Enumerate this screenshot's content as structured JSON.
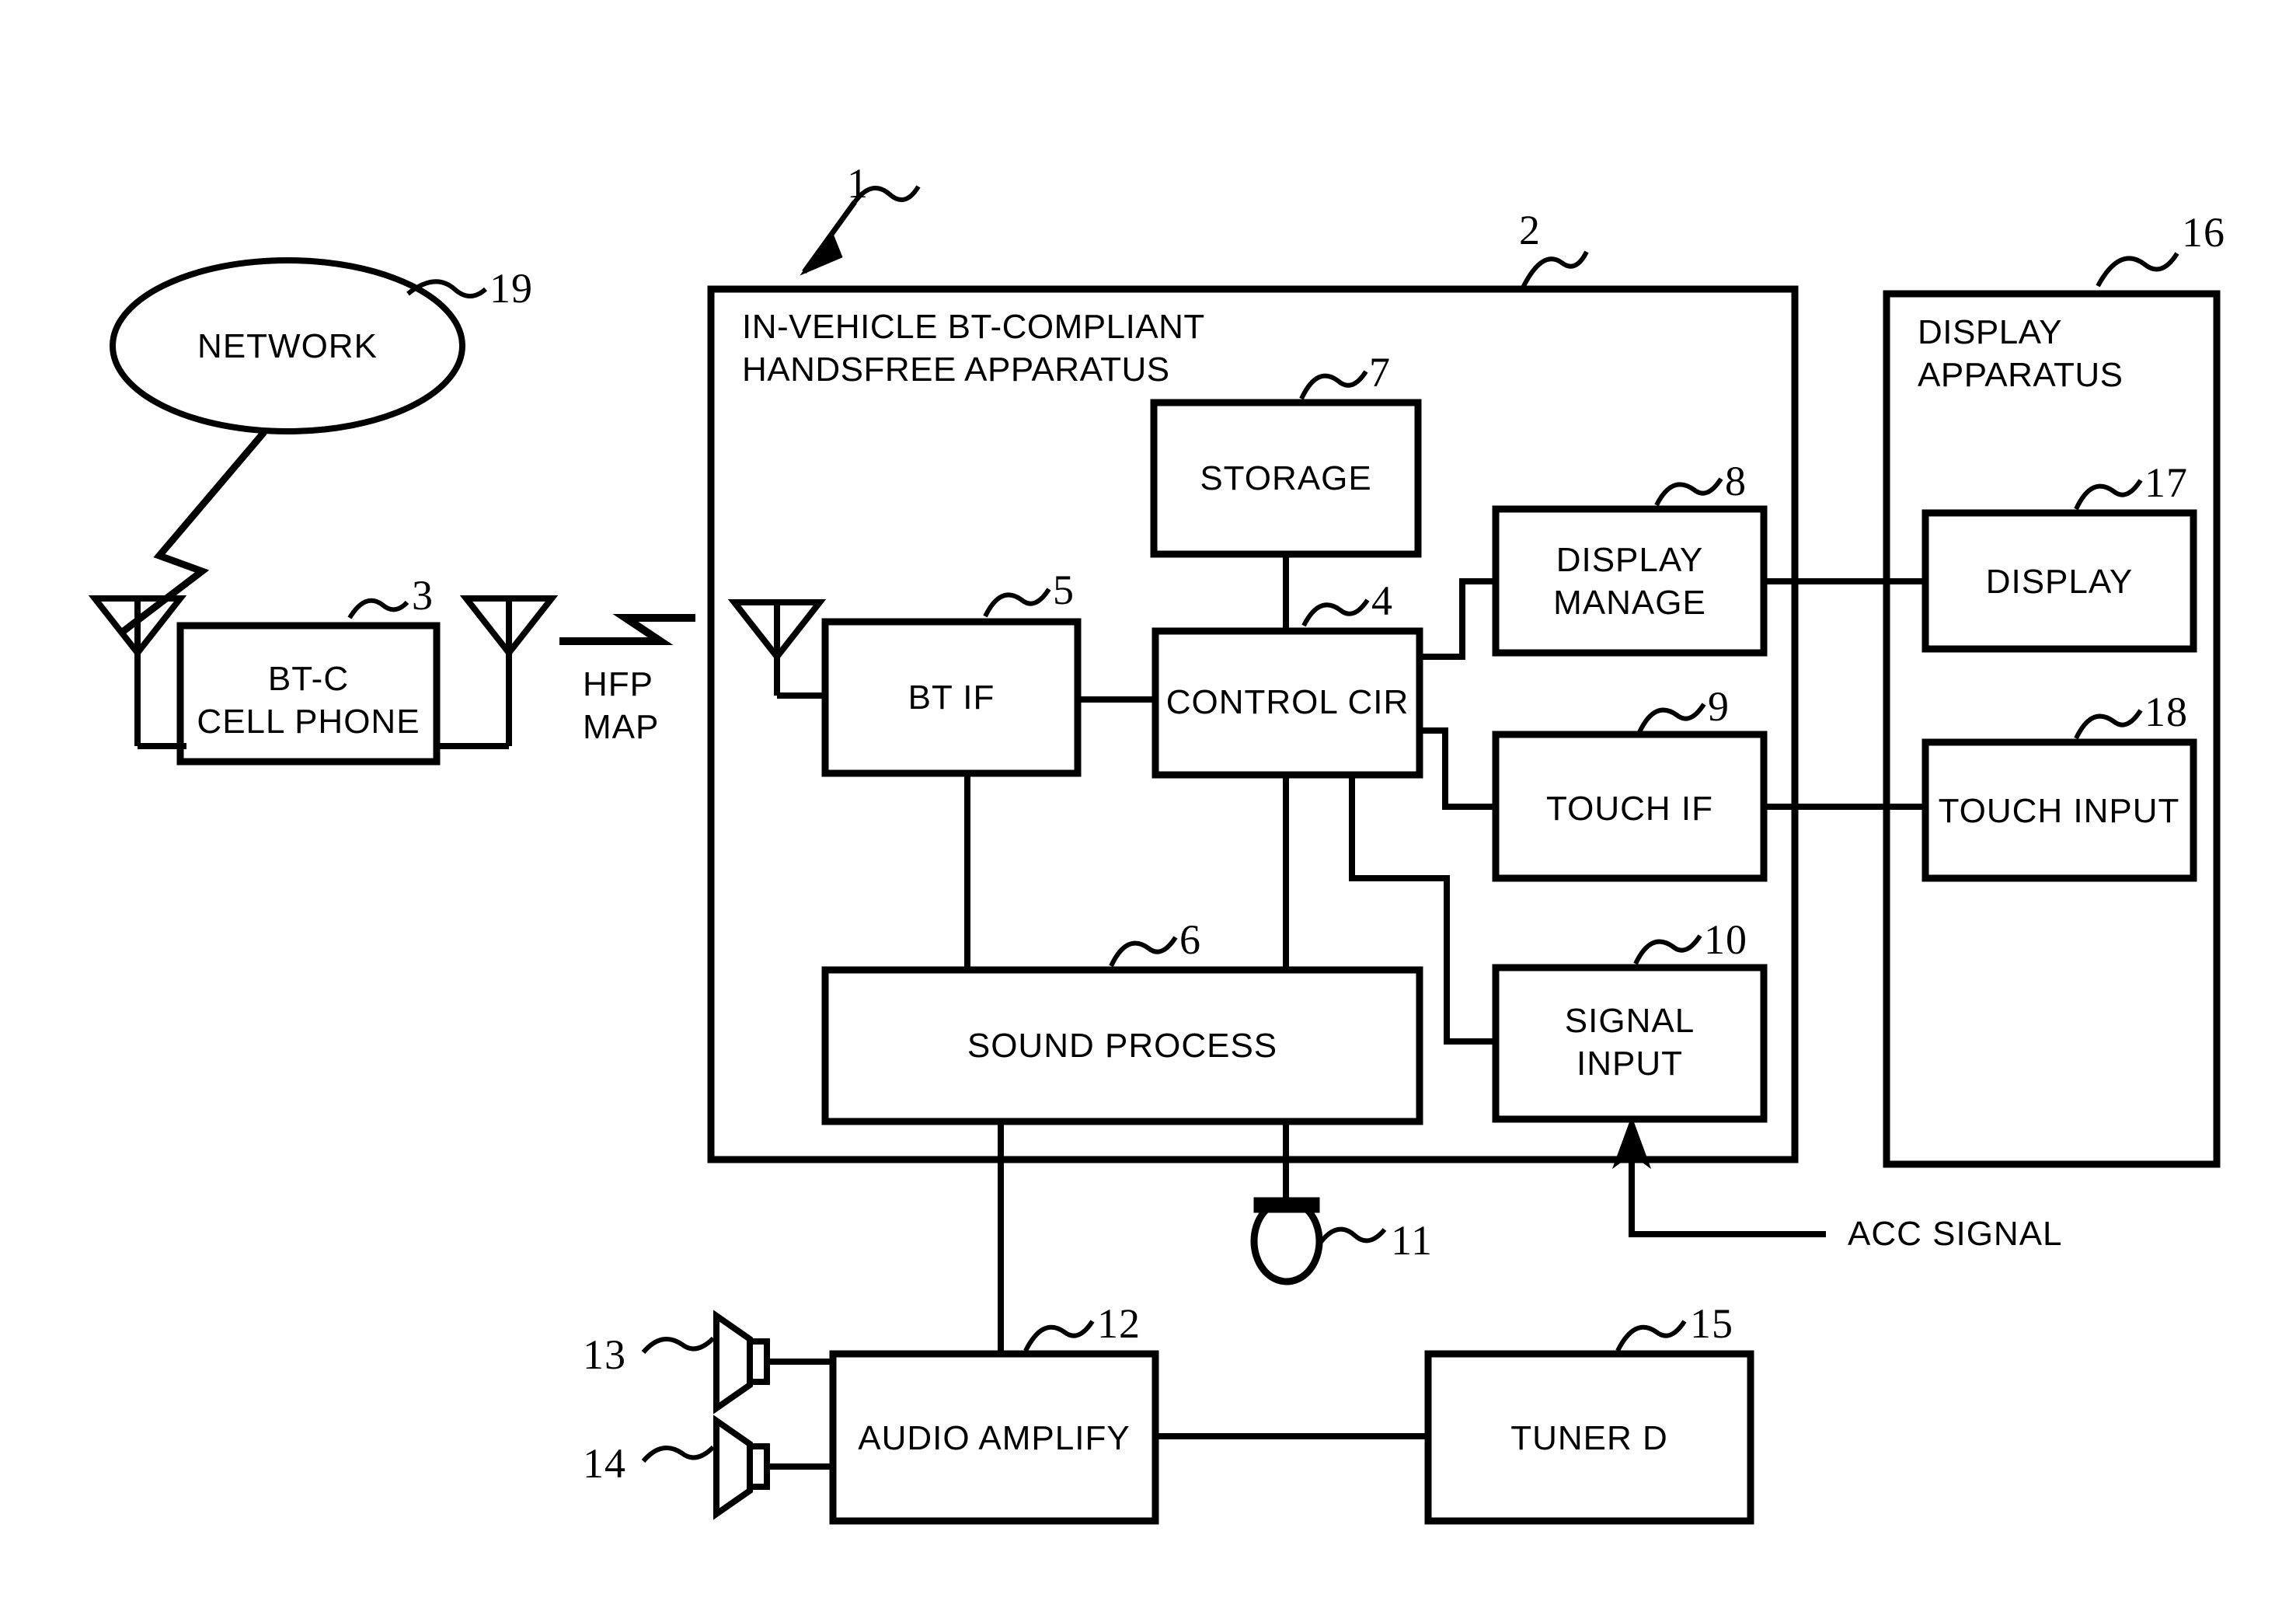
{
  "figure": {
    "type": "patent-block-diagram",
    "background": "#ffffff",
    "stroke": "#000000"
  },
  "containers": [
    {
      "id": "apparatus",
      "label_line1": "IN-VEHICLE BT-COMPLIANT",
      "label_line2": "HANDSFREE APPARATUS",
      "ref": "1",
      "ref_inner": "2"
    },
    {
      "id": "display_apparatus",
      "label_line1": "DISPLAY",
      "label_line2": "APPARATUS",
      "ref": "16"
    }
  ],
  "blocks": [
    {
      "id": "network",
      "label": "NETWORK",
      "ref": "19"
    },
    {
      "id": "cell_phone",
      "label_line1": "BT-C",
      "label_line2": "CELL PHONE",
      "ref": "3"
    },
    {
      "id": "storage",
      "label": "STORAGE",
      "ref": "7"
    },
    {
      "id": "bt_if",
      "label": "BT IF",
      "ref": "5"
    },
    {
      "id": "control_cir",
      "label": "CONTROL CIR",
      "ref": "4"
    },
    {
      "id": "display_manage",
      "label_line1": "DISPLAY",
      "label_line2": "MANAGE",
      "ref": "8"
    },
    {
      "id": "touch_if",
      "label": "TOUCH IF",
      "ref": "9"
    },
    {
      "id": "signal_input",
      "label_line1": "SIGNAL",
      "label_line2": "INPUT",
      "ref": "10"
    },
    {
      "id": "sound_process",
      "label": "SOUND PROCESS",
      "ref": "6"
    },
    {
      "id": "display",
      "label": "DISPLAY",
      "ref": "17"
    },
    {
      "id": "touch_input",
      "label": "TOUCH INPUT",
      "ref": "18"
    },
    {
      "id": "audio_amplify",
      "label": "AUDIO AMPLIFY",
      "ref": "12"
    },
    {
      "id": "tuner_d",
      "label": "TUNER D",
      "ref": "15"
    }
  ],
  "components": [
    {
      "id": "microphone",
      "ref": "11"
    },
    {
      "id": "speaker_front",
      "ref": "13"
    },
    {
      "id": "speaker_rear",
      "ref": "14"
    }
  ],
  "signals": [
    {
      "id": "bt_profiles",
      "line1": "HFP",
      "line2": "MAP"
    },
    {
      "id": "acc_signal",
      "label": "ACC SIGNAL"
    }
  ],
  "refs": {
    "r1": "1",
    "r2": "2",
    "r3": "3",
    "r4": "4",
    "r5": "5",
    "r6": "6",
    "r7": "7",
    "r8": "8",
    "r9": "9",
    "r10": "10",
    "r11": "11",
    "r12": "12",
    "r13": "13",
    "r14": "14",
    "r15": "15",
    "r16": "16",
    "r17": "17",
    "r18": "18",
    "r19": "19"
  },
  "text": {
    "network": "NETWORK",
    "btc": "BT-C",
    "cell_phone": "CELL PHONE",
    "hfp": "HFP",
    "map": "MAP",
    "apparatus_l1": "IN-VEHICLE BT-COMPLIANT",
    "apparatus_l2": "HANDSFREE APPARATUS",
    "storage": "STORAGE",
    "bt_if": "BT IF",
    "control_cir": "CONTROL CIR",
    "display_manage_l1": "DISPLAY",
    "display_manage_l2": "MANAGE",
    "touch_if": "TOUCH IF",
    "signal_input_l1": "SIGNAL",
    "signal_input_l2": "INPUT",
    "sound_process": "SOUND PROCESS",
    "display_apparatus_l1": "DISPLAY",
    "display_apparatus_l2": "APPARATUS",
    "display": "DISPLAY",
    "touch_input": "TOUCH INPUT",
    "audio_amplify": "AUDIO AMPLIFY",
    "tuner_d": "TUNER D",
    "acc_signal": "ACC SIGNAL"
  }
}
